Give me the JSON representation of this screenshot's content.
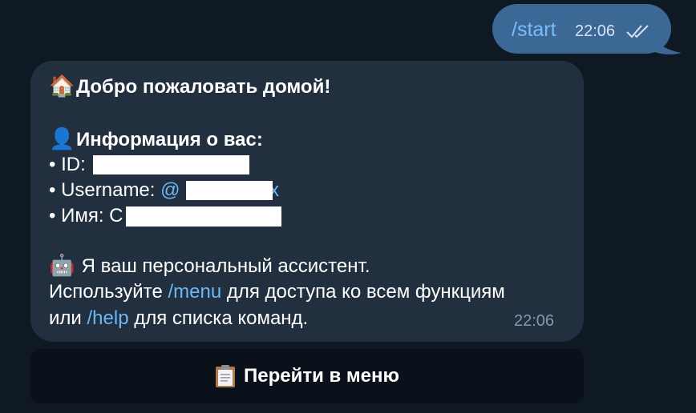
{
  "outgoing": {
    "text": "/start",
    "time": "22:06"
  },
  "incoming": {
    "home_emoji": "🏠",
    "welcome": "Добро пожаловать домой!",
    "user_emoji": "👤",
    "info_title": "Информация о вас:",
    "id_label": "• ID:",
    "username_label": "• Username:",
    "username_prefix": "@",
    "username_suffix": "x",
    "name_label": "• Имя: С",
    "robot_emoji": "🤖",
    "assistant_line": "Я ваш персональный ассистент.",
    "use_prefix": "Используйте",
    "menu_cmd": "/menu",
    "use_suffix": "для доступа ко всем функциям",
    "or_prefix": "или",
    "help_cmd": "/help",
    "or_suffix": "для списка команд.",
    "time": "22:06"
  },
  "keyboard": {
    "button_label": "Перейти в меню",
    "button_icon": "clipboard-icon"
  },
  "colors": {
    "background": "#0f1923",
    "outgoing_bubble": "#3c6896",
    "incoming_bubble": "#212f3f",
    "link": "#6db8f5",
    "button_bg": "#0a111a"
  }
}
